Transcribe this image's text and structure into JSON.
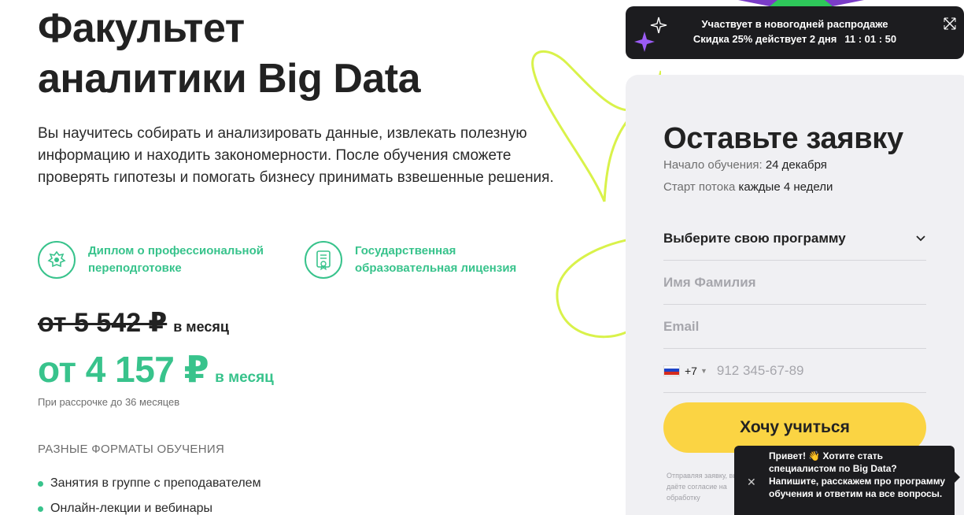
{
  "hero": {
    "title_line1": "Факультет",
    "title_line2": "аналитики Big Data",
    "description": "Вы научитесь собирать и анализировать данные, извлекать полезную информацию и находить закономерности. После обучения сможете проверять гипотезы и помогать бизнесу принимать взвешенные решения."
  },
  "features": [
    {
      "icon": "emblem-icon",
      "label": "Диплом о профессиональной переподготовке"
    },
    {
      "icon": "certificate-icon",
      "label": "Государственная образовательная лицензия"
    }
  ],
  "pricing": {
    "old_amount": "от 5 542 ₽",
    "old_period": "в месяц",
    "new_amount": "от 4 157 ₽",
    "new_period": "в месяц",
    "installment_note": "При рассрочке до 36 месяцев"
  },
  "formats": {
    "heading": "РАЗНЫЕ ФОРМАТЫ ОБУЧЕНИЯ",
    "items": [
      "Занятия в группе с преподавателем",
      "Онлайн-лекции и вебинары"
    ]
  },
  "promo": {
    "line1": "Участвует в новогодней распродаже",
    "discount_prefix": "Скидка ",
    "discount": "25%",
    "discount_middle": " действует ",
    "days": "2",
    "days_label": " дня",
    "timer": "11 : 01 : 50"
  },
  "form": {
    "title": "Оставьте заявку",
    "start_label": "Начало обучения:",
    "start_value": "24 декабря",
    "stream_label": "Старт потока",
    "stream_value": "каждые 4 недели",
    "program_select": "Выберите свою программу",
    "name_placeholder": "Имя Фамилия",
    "email_placeholder": "Email",
    "phone_code": "+7",
    "phone_placeholder": "912 345-67-89",
    "submit_label": "Хочу учиться",
    "consent_text": "Отправляя заявку, вы даёте согласие на обработку"
  },
  "chat": {
    "message": "Привет! 👋 Хотите стать специалистом по Big Data? Напишите, расскажем про программу обучения и ответим на все вопросы."
  },
  "colors": {
    "accent_green": "#38c38c",
    "button_yellow": "#fbd443",
    "dark": "#1c1c1f",
    "card_bg": "#f0f0f3",
    "deco_lime": "#d9f24a"
  }
}
